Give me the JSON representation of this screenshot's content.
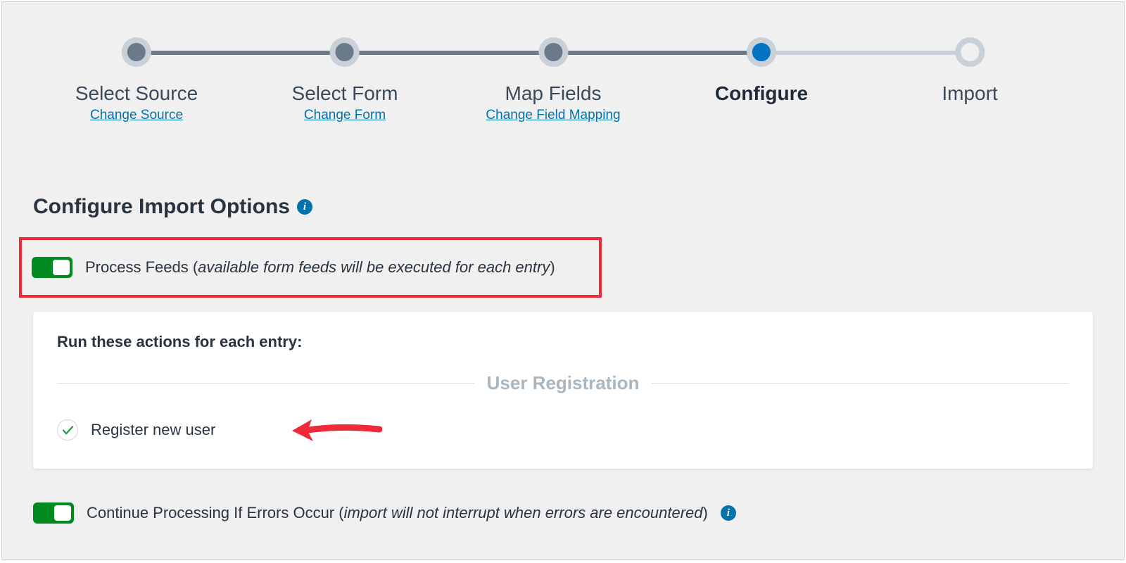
{
  "stepper": {
    "steps": [
      {
        "label": "Select Source",
        "link": "Change Source",
        "state": "done"
      },
      {
        "label": "Select Form",
        "link": "Change Form",
        "state": "done"
      },
      {
        "label": "Map Fields",
        "link": "Change Field Mapping",
        "state": "done"
      },
      {
        "label": "Configure",
        "link": "",
        "state": "current"
      },
      {
        "label": "Import",
        "link": "",
        "state": "future"
      }
    ]
  },
  "section_title": "Configure Import Options",
  "process_feeds": {
    "label": "Process Feeds ",
    "note_open": "(",
    "note": "available form feeds will be executed for each entry",
    "note_close": ")"
  },
  "card": {
    "title": "Run these actions for each entry:",
    "group": "User Registration",
    "action": "Register new user"
  },
  "continue_processing": {
    "label": "Continue Processing If Errors Occur ",
    "note_open": "(",
    "note": "import will not interrupt when errors are encountered",
    "note_close": ")"
  }
}
